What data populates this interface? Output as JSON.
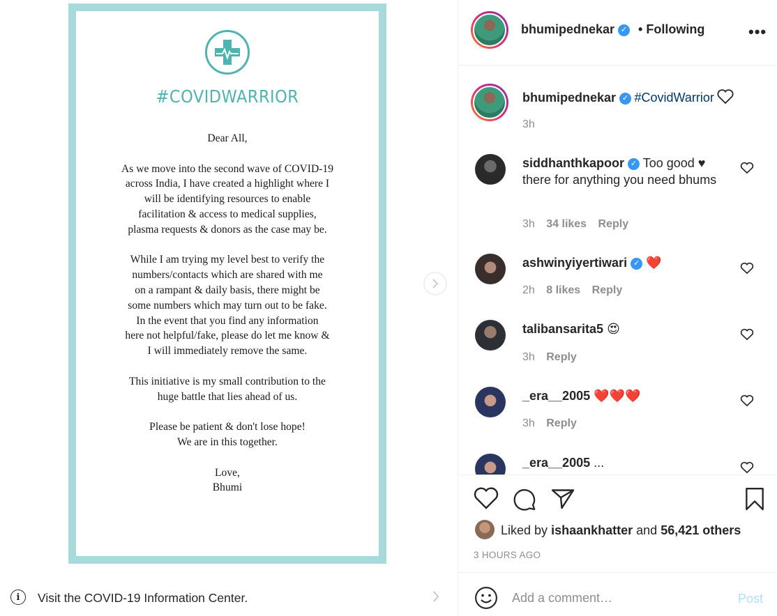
{
  "post": {
    "hashtag_title": "#COVIDWARRIOR",
    "letter": [
      "Dear All,",
      "As we move into the second wave of COVID-19\nacross India, I have created a highlight where I\nwill be identifying  resources to enable\nfacilitation & access to medical supplies,\nplasma requests & donors as the case may be.",
      "While I am trying my level best to verify the\nnumbers/contacts which are shared with me\non a rampant & daily basis, there might be\nsome numbers which may turn out to be fake.\nIn the event that you find any information\nhere not helpful/fake, please do let me know &\nI will immediately remove the same.",
      "This initiative is my small contribution to the\nhuge battle that lies ahead of us.",
      "Please be patient & don't lose hope!\nWe are in this together.",
      "Love,\nBhumi"
    ]
  },
  "info_bar": {
    "text": "Visit the COVID-19 Information Center."
  },
  "header": {
    "username": "bhumipednekar",
    "separator": "•",
    "following_label": "Following",
    "more": "•••"
  },
  "caption": {
    "username": "bhumipednekar",
    "hashtag": "#CovidWarrior",
    "time": "3h"
  },
  "comments": [
    {
      "username": "siddhanthkapoor",
      "verified": true,
      "text": "Too good ♥ there for anything you need bhums",
      "time": "3h",
      "likes": "34 likes",
      "reply": "Reply"
    },
    {
      "username": "ashwinyiyertiwari",
      "verified": true,
      "text": "❤️",
      "time": "2h",
      "likes": "8 likes",
      "reply": "Reply"
    },
    {
      "username": "talibansarita5",
      "verified": false,
      "text": "😍",
      "time": "3h",
      "likes": "",
      "reply": "Reply"
    },
    {
      "username": "_era__2005",
      "verified": false,
      "text": "❤️❤️❤️",
      "time": "3h",
      "likes": "",
      "reply": "Reply"
    },
    {
      "username": "_era__2005",
      "verified": false,
      "text": "...",
      "time": "",
      "likes": "",
      "reply": ""
    }
  ],
  "likes": {
    "liked_by_prefix": "Liked by",
    "liked_by_user": "ishaankhatter",
    "and": "and",
    "others": "56,421 others"
  },
  "time_ago": "3 HOURS AGO",
  "comment_input": {
    "placeholder": "Add a comment…",
    "post_label": "Post"
  },
  "colors": {
    "accent_blue": "#3897f0",
    "card_border": "#a8dadc",
    "teal": "#4fb3b1",
    "heart_red": "#ed4956"
  },
  "icons": [
    "medical-cross-icon",
    "chevron-right-icon",
    "info-icon",
    "verified-icon",
    "more-icon",
    "heart-icon",
    "comment-icon",
    "share-icon",
    "bookmark-icon",
    "emoji-icon"
  ]
}
